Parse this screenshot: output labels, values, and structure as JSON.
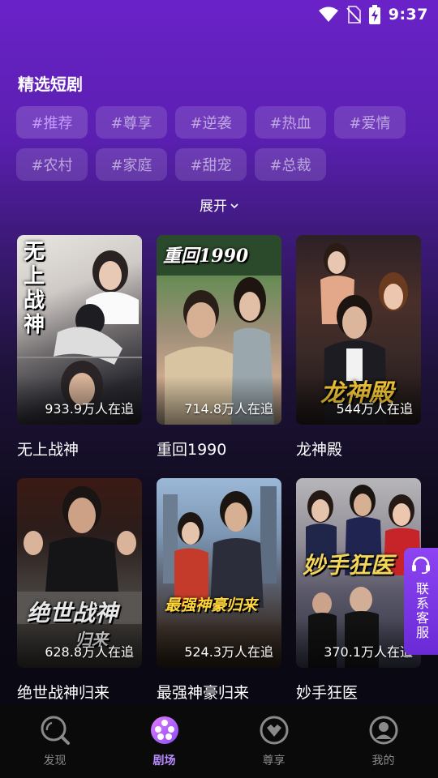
{
  "status": {
    "time": "9:37",
    "icons": [
      "wifi-icon",
      "no-sim-icon",
      "battery-charging-icon"
    ]
  },
  "section_title": "精选短剧",
  "tags": [
    {
      "label": "#推荐",
      "active": true
    },
    {
      "label": "#尊享",
      "active": false
    },
    {
      "label": "#逆袭",
      "active": false
    },
    {
      "label": "#热血",
      "active": false
    },
    {
      "label": "#爱情",
      "active": false
    },
    {
      "label": "#农村",
      "active": false
    },
    {
      "label": "#家庭",
      "active": false
    },
    {
      "label": "#甜宠",
      "active": false
    },
    {
      "label": "#总裁",
      "active": false
    }
  ],
  "expand_label": "展开",
  "dramas": [
    {
      "name": "无上战神",
      "followers": "933.9万人在追",
      "poster_text": "无上战神"
    },
    {
      "name": "重回1990",
      "followers": "714.8万人在追",
      "poster_text": "重回1990"
    },
    {
      "name": "龙神殿",
      "followers": "544万人在追",
      "poster_text": "龙神殿"
    },
    {
      "name": "绝世战神归来",
      "followers": "628.8万人在追",
      "poster_text": "绝世战神归来"
    },
    {
      "name": "最强神豪归来",
      "followers": "524.3万人在追",
      "poster_text": "最强神豪归来"
    },
    {
      "name": "妙手狂医",
      "followers": "370.1万人在追",
      "poster_text": "妙手狂医"
    }
  ],
  "service_label": "联系客服",
  "tabs": [
    {
      "label": "发现",
      "icon": "discover-icon",
      "active": false
    },
    {
      "label": "剧场",
      "icon": "theater-icon",
      "active": true
    },
    {
      "label": "尊享",
      "icon": "vip-icon",
      "active": false
    },
    {
      "label": "我的",
      "icon": "profile-icon",
      "active": false
    }
  ],
  "colors": {
    "accent": "#b98cff",
    "active_tag_text": "#c59bff",
    "service_bg": "#7b38e8"
  }
}
